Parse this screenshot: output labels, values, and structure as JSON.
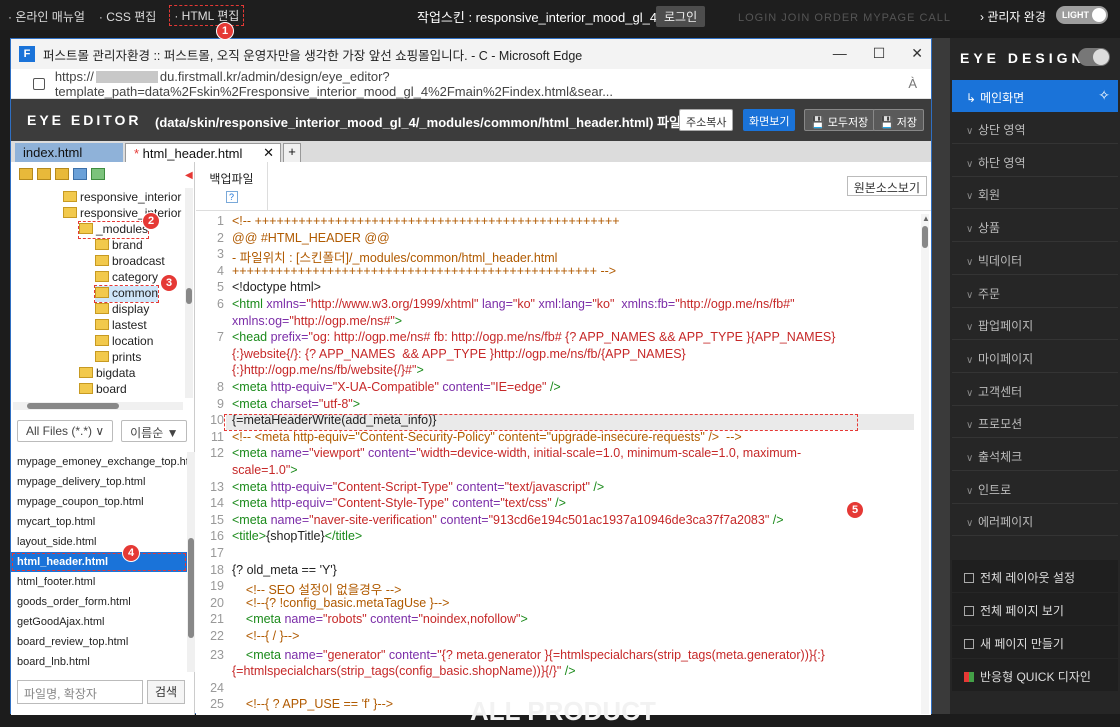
{
  "topbar": {
    "manual": "· 온라인 매뉴얼",
    "css_edit": "· CSS 편집",
    "html_edit": "· HTML 편집",
    "skin": "작업스킨 : responsive_interior_mood_gl_4",
    "login": "로그인",
    "ghost_menu": "LOGIN    JOIN    ORDER    MYPAGE    CALL",
    "admin_done": "› 관리자 완경",
    "toggle_label": "LIGHT"
  },
  "badges": [
    "1",
    "2",
    "3",
    "4",
    "5"
  ],
  "window": {
    "title": "퍼스트몰 관리자환경 :: 퍼스트몰, 오직 운영자만을 생각한 가장 앞선 쇼핑몰입니다. - C - Microsoft Edge",
    "app_letter": "F",
    "url_prefix": "https://",
    "url_rest": "du.firstmall.kr/admin/design/eye_editor?template_path=data%2Fskin%2Fresponsive_interior_mood_gl_4%2Fmain%2Findex.html&sear...",
    "aa": "À"
  },
  "editor_header": {
    "logo": "EYE EDITOR",
    "path": "(data/skin/responsive_interior_mood_gl_4/_modules/common/html_header.html) 파일",
    "copy_btn": "주소복사",
    "view_btn": "화면보기",
    "save_all_btn": "모두저장",
    "save_btn": "저장"
  },
  "tabs": [
    {
      "label": "index.html"
    },
    {
      "label": "html_header.html",
      "modified": "* "
    }
  ],
  "tree": {
    "items": [
      "responsive_interior",
      "responsive_interior",
      "_modules",
      "brand",
      "broadcast",
      "category",
      "common",
      "display",
      "lastest",
      "location",
      "prints",
      "bigdata",
      "board"
    ]
  },
  "filters": {
    "type": "All Files (*.*) ∨",
    "sort": "이름순 ▼"
  },
  "files": [
    "mypage_emoney_exchange_top.html",
    "mypage_delivery_top.html",
    "mypage_coupon_top.html",
    "mycart_top.html",
    "layout_side.html",
    "html_header.html",
    "html_footer.html",
    "goods_order_form.html",
    "getGoodAjax.html",
    "board_review_top.html",
    "board_lnb.html"
  ],
  "search": {
    "placeholder": "파일명, 확장자",
    "button": "검색"
  },
  "backup": {
    "label": "백업파일",
    "help": "?"
  },
  "source_btn": "원본소스보기",
  "code_lines": [
    {
      "n": "1",
      "parts": [
        [
          "c-com",
          "<!-- ++++++++++++++++++++++++++++++++++++++++++++++++++"
        ]
      ]
    },
    {
      "n": "2",
      "parts": [
        [
          "c-com",
          "@@ #HTML_HEADER @@"
        ]
      ]
    },
    {
      "n": "3",
      "parts": [
        [
          "c-com",
          "- 파일위치 : [스킨폴더]/_modules/common/html_header.html"
        ]
      ]
    },
    {
      "n": "4",
      "parts": [
        [
          "c-com",
          "++++++++++++++++++++++++++++++++++++++++++++++++++ -->"
        ]
      ]
    },
    {
      "n": "5",
      "parts": [
        [
          "c-plain",
          "<!doctype html>"
        ]
      ]
    },
    {
      "n": "6",
      "parts": [
        [
          "c-tag",
          "<html "
        ],
        [
          "c-attr",
          "xmlns="
        ],
        [
          "c-str",
          "\"http://www.w3.org/1999/xhtml\""
        ],
        [
          "c-attr",
          " lang="
        ],
        [
          "c-str",
          "\"ko\""
        ],
        [
          "c-attr",
          " xml:lang="
        ],
        [
          "c-str",
          "\"ko\""
        ],
        [
          "c-attr",
          "  xmlns:fb="
        ],
        [
          "c-str",
          "\"http://ogp.me/ns/fb#\""
        ]
      ]
    },
    {
      "n": "",
      "parts": [
        [
          "c-attr",
          "xmlns:og="
        ],
        [
          "c-str",
          "\"http://ogp.me/ns#\""
        ],
        [
          "c-tag",
          ">"
        ]
      ]
    },
    {
      "n": "7",
      "parts": [
        [
          "c-tag",
          "<head "
        ],
        [
          "c-attr",
          "prefix="
        ],
        [
          "c-str",
          "\"og: http://ogp.me/ns# fb: http://ogp.me/ns/fb# {? APP_NAMES && APP_TYPE }{APP_NAMES}"
        ]
      ]
    },
    {
      "n": "",
      "parts": [
        [
          "c-str",
          "{:}website{/}: {? APP_NAMES  && APP_TYPE }http://ogp.me/ns/fb/{APP_NAMES}"
        ]
      ]
    },
    {
      "n": "",
      "parts": [
        [
          "c-str",
          "{:}http://ogp.me/ns/fb/website{/}#\""
        ],
        [
          "c-tag",
          ">"
        ]
      ]
    },
    {
      "n": "8",
      "parts": [
        [
          "c-tag",
          "<meta "
        ],
        [
          "c-attr",
          "http-equiv="
        ],
        [
          "c-str",
          "\"X-UA-Compatible\""
        ],
        [
          "c-attr",
          " content="
        ],
        [
          "c-str",
          "\"IE=edge\""
        ],
        [
          "c-tag",
          " />"
        ]
      ]
    },
    {
      "n": "9",
      "parts": [
        [
          "c-tag",
          "<meta "
        ],
        [
          "c-attr",
          "charset="
        ],
        [
          "c-str",
          "\"utf-8\""
        ],
        [
          "c-tag",
          ">"
        ]
      ]
    },
    {
      "n": "10",
      "parts": [
        [
          "c-plain",
          "{=metaHeaderWrite(add_meta_info)}"
        ]
      ]
    },
    {
      "n": "11",
      "parts": [
        [
          "c-com",
          "<!-- <meta http-equiv=\"Content-Security-Policy\" content=\"upgrade-insecure-requests\" />  -->"
        ]
      ]
    },
    {
      "n": "12",
      "parts": [
        [
          "c-tag",
          "<meta "
        ],
        [
          "c-attr",
          "name="
        ],
        [
          "c-str",
          "\"viewport\""
        ],
        [
          "c-attr",
          " content="
        ],
        [
          "c-str",
          "\"width=device-width, initial-scale=1.0, minimum-scale=1.0, maximum-"
        ]
      ]
    },
    {
      "n": "",
      "parts": [
        [
          "c-str",
          "scale=1.0\""
        ],
        [
          "c-tag",
          ">"
        ]
      ]
    },
    {
      "n": "13",
      "parts": [
        [
          "c-tag",
          "<meta "
        ],
        [
          "c-attr",
          "http-equiv="
        ],
        [
          "c-str",
          "\"Content-Script-Type\""
        ],
        [
          "c-attr",
          " content="
        ],
        [
          "c-str",
          "\"text/javascript\""
        ],
        [
          "c-tag",
          " />"
        ]
      ]
    },
    {
      "n": "14",
      "parts": [
        [
          "c-tag",
          "<meta "
        ],
        [
          "c-attr",
          "http-equiv="
        ],
        [
          "c-str",
          "\"Content-Style-Type\""
        ],
        [
          "c-attr",
          " content="
        ],
        [
          "c-str",
          "\"text/css\""
        ],
        [
          "c-tag",
          " />"
        ]
      ]
    },
    {
      "n": "15",
      "parts": [
        [
          "c-tag",
          "<meta "
        ],
        [
          "c-attr",
          "name="
        ],
        [
          "c-str",
          "\"naver-site-verification\""
        ],
        [
          "c-attr",
          " content="
        ],
        [
          "c-str",
          "\"913cd6e194c501ac1937a10946de3ca37f7a2083\""
        ],
        [
          "c-tag",
          " />"
        ]
      ]
    },
    {
      "n": "16",
      "parts": [
        [
          "c-tag",
          "<title>"
        ],
        [
          "c-plain",
          "{shopTitle}"
        ],
        [
          "c-tag",
          "</title>"
        ]
      ]
    },
    {
      "n": "17",
      "parts": [
        [
          "c-plain",
          ""
        ]
      ]
    },
    {
      "n": "18",
      "parts": [
        [
          "c-plain",
          "{? old_meta == 'Y'}"
        ]
      ]
    },
    {
      "n": "19",
      "parts": [
        [
          "c-com",
          "    <!-- SEO 설정이 없을경우 -->"
        ]
      ]
    },
    {
      "n": "20",
      "parts": [
        [
          "c-com",
          "    <!--{? !config_basic.metaTagUse }-->"
        ]
      ]
    },
    {
      "n": "21",
      "parts": [
        [
          "c-tag",
          "    <meta "
        ],
        [
          "c-attr",
          "name="
        ],
        [
          "c-str",
          "\"robots\""
        ],
        [
          "c-attr",
          " content="
        ],
        [
          "c-str",
          "\"noindex,nofollow\""
        ],
        [
          "c-tag",
          ">"
        ]
      ]
    },
    {
      "n": "22",
      "parts": [
        [
          "c-com",
          "    <!--{ / }-->"
        ]
      ]
    },
    {
      "n": "23",
      "parts": [
        [
          "c-tag",
          "    <meta "
        ],
        [
          "c-attr",
          "name="
        ],
        [
          "c-str",
          "\"generator\""
        ],
        [
          "c-attr",
          " content="
        ],
        [
          "c-str",
          "\"{? meta.generator }{=htmlspecialchars(strip_tags(meta.generator))}{:}"
        ]
      ]
    },
    {
      "n": "",
      "parts": [
        [
          "c-str",
          "{=htmlspecialchars(strip_tags(config_basic.shopName))}{/}\""
        ],
        [
          "c-tag",
          " />"
        ]
      ]
    },
    {
      "n": "24",
      "parts": [
        [
          "c-plain",
          ""
        ]
      ]
    },
    {
      "n": "25",
      "parts": [
        [
          "c-com",
          "    <!--{ ? APP_USE == 'f' }-->"
        ]
      ]
    }
  ],
  "side_panel": {
    "brand": "EYE DESIGN",
    "main": "메인화면",
    "items": [
      "상단 영역",
      "하단 영역",
      "회원",
      "상품",
      "빅데이터",
      "주문",
      "팝업페이지",
      "마이페이지",
      "고객센터",
      "프로모션",
      "출석체크",
      "인트로",
      "에러페이지"
    ],
    "bottom": [
      "전체 레이아웃 설정",
      "전체 페이지 보기",
      "새 페이지 만들기",
      "반응형 QUICK 디자인"
    ]
  },
  "bg_text": "ALL PRODUCT"
}
